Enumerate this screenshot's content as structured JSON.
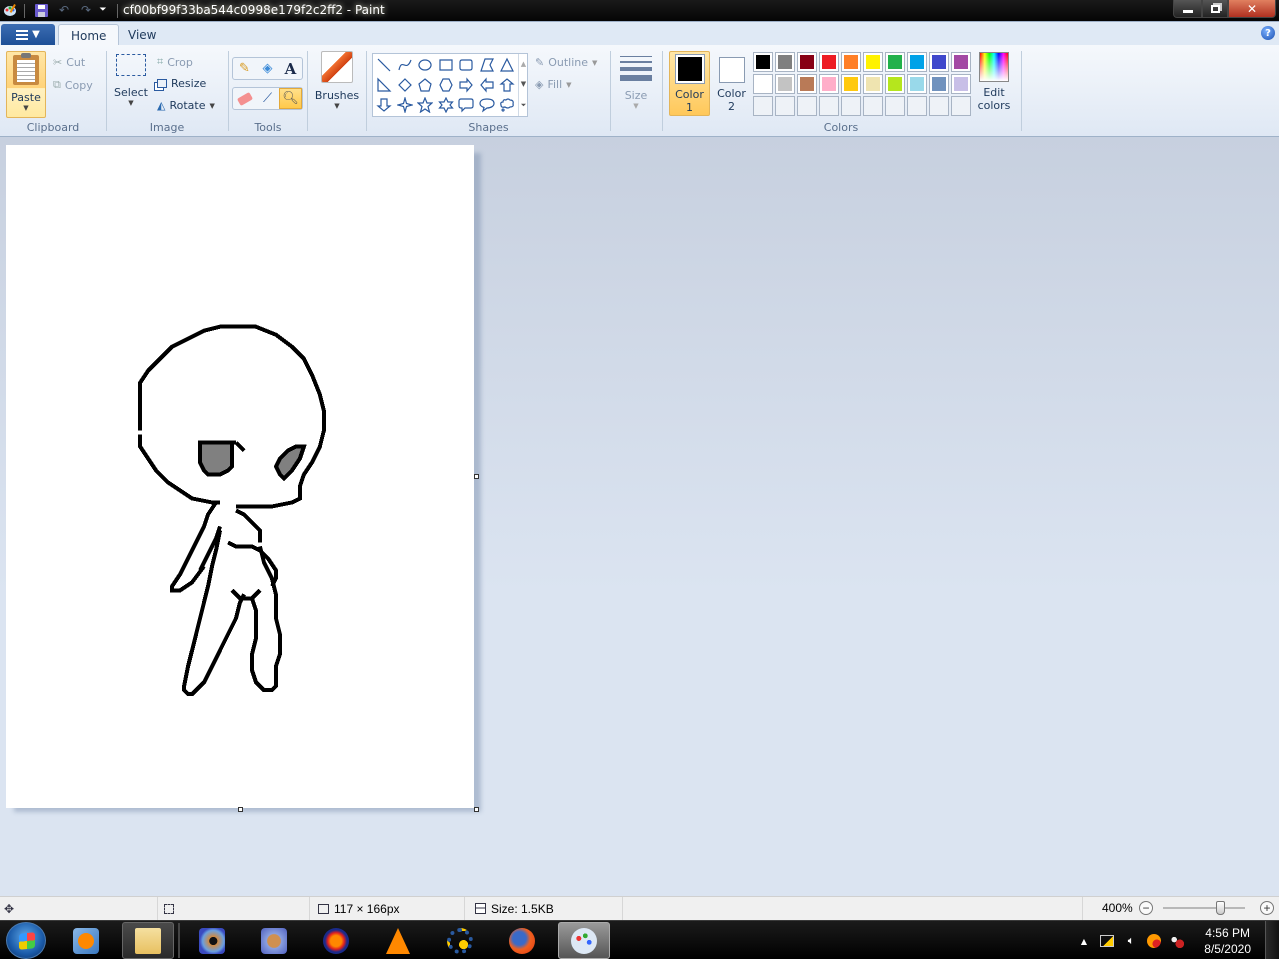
{
  "window": {
    "title": "cf00bf99f33ba544c0998e179f2c2ff2 - Paint",
    "quick_access": [
      "paint-app-icon",
      "save-icon",
      "undo-icon",
      "redo-icon",
      "customize-dropdown-icon"
    ],
    "controls": {
      "minimize": "minimize",
      "maximize": "restore",
      "close": "close"
    }
  },
  "tabs": {
    "app_menu": "menu",
    "items": [
      {
        "label": "Home",
        "active": true
      },
      {
        "label": "View",
        "active": false
      }
    ],
    "help": "?"
  },
  "ribbon": {
    "clipboard": {
      "label": "Clipboard",
      "paste": "Paste",
      "cut": "Cut",
      "copy": "Copy"
    },
    "image": {
      "label": "Image",
      "select": "Select",
      "crop": "Crop",
      "resize": "Resize",
      "rotate": "Rotate"
    },
    "tools": {
      "label": "Tools",
      "items": [
        "pencil",
        "fill",
        "text",
        "eraser",
        "color-picker",
        "magnifier"
      ],
      "active": "magnifier"
    },
    "brushes": {
      "label": "Brushes"
    },
    "shapes": {
      "label": "Shapes",
      "outline": "Outline",
      "fill": "Fill",
      "items": [
        "line",
        "curve",
        "oval",
        "rectangle",
        "rounded-rectangle",
        "polygon",
        "triangle",
        "right-triangle",
        "diamond",
        "pentagon",
        "hexagon",
        "right-arrow",
        "left-arrow",
        "up-arrow",
        "down-arrow",
        "four-point-star",
        "five-point-star",
        "six-point-star",
        "rounded-callout",
        "oval-callout",
        "cloud-callout"
      ]
    },
    "size": {
      "label": "Size"
    },
    "colors": {
      "label": "Colors",
      "color1": {
        "label_line1": "Color",
        "label_line2": "1",
        "value": "#000000"
      },
      "color2": {
        "label_line1": "Color",
        "label_line2": "2",
        "value": "#ffffff"
      },
      "palette_row1": [
        "#000000",
        "#7f7f7f",
        "#880015",
        "#ed1c24",
        "#ff7f27",
        "#fff200",
        "#22b14c",
        "#00a2e8",
        "#3f48cc",
        "#a349a4"
      ],
      "palette_row2": [
        "#ffffff",
        "#c3c3c3",
        "#b97a57",
        "#ffaec9",
        "#ffc90e",
        "#efe4b0",
        "#b5e61d",
        "#99d9ea",
        "#7092be",
        "#c8bfe7"
      ],
      "palette_row3_empty": 10,
      "edit_colors_line1": "Edit",
      "edit_colors_line2": "colors"
    }
  },
  "status": {
    "cursor_pos": "",
    "selection_size": "",
    "image_size": "117 × 166px",
    "file_size": "Size: 1.5KB",
    "zoom": "400%",
    "zoom_level_percent": 400
  },
  "taskbar": {
    "items": [
      {
        "name": "windows-media-player",
        "open": false
      },
      {
        "name": "windows-explorer",
        "open": true
      },
      {
        "name": "app-blue-eye",
        "open": false
      },
      {
        "name": "app-compass",
        "open": false
      },
      {
        "name": "audacity",
        "open": false
      },
      {
        "name": "vlc",
        "open": false
      },
      {
        "name": "settings-shield",
        "open": false
      },
      {
        "name": "firefox",
        "open": false
      },
      {
        "name": "paint",
        "open": true,
        "active": true
      }
    ],
    "clock_time": "4:56 PM",
    "clock_date": "8/5/2020"
  }
}
